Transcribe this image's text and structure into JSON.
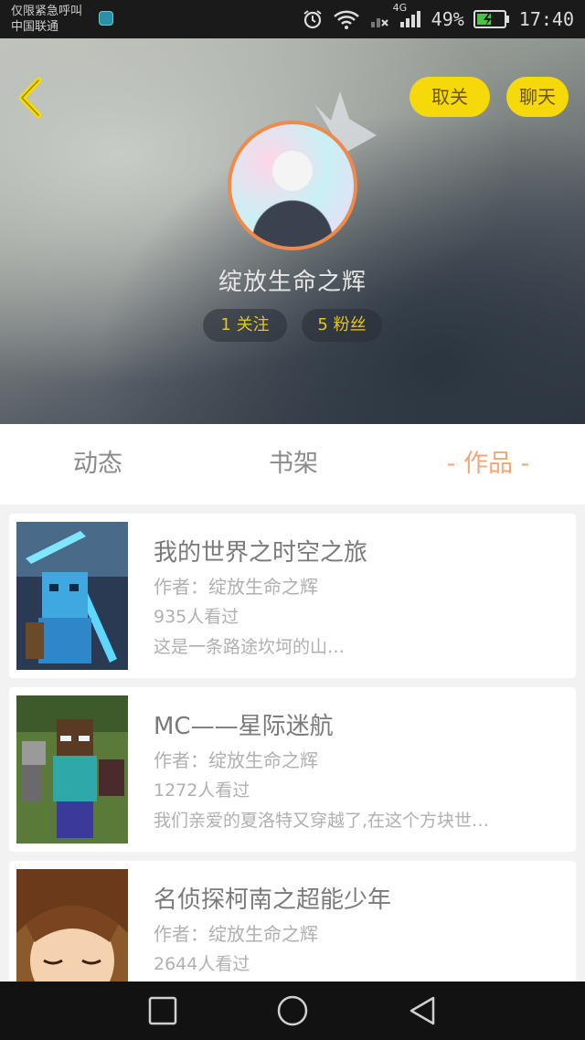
{
  "status_bar": {
    "emergency_text": "仅限紧急呼叫",
    "carrier": "中国联通",
    "network_label": "4G",
    "battery_percent": "49%",
    "time": "17:40"
  },
  "header": {
    "unfollow_label": "取关",
    "chat_label": "聊天",
    "username": "绽放生命之辉",
    "following": "1 关注",
    "fans": "5 粉丝",
    "accent_color": "#f5d90a"
  },
  "tabs": {
    "items": [
      {
        "label": "动态"
      },
      {
        "label": "书架"
      },
      {
        "label": "- 作品 -"
      }
    ],
    "active_color": "#f0a77a"
  },
  "works": [
    {
      "title": "我的世界之时空之旅",
      "author": "作者：绽放生命之辉",
      "views": "935人看过",
      "desc": "这是一条路途坎坷的山…"
    },
    {
      "title": "MC——星际迷航",
      "author": "作者：绽放生命之辉",
      "views": "1272人看过",
      "desc": "我们亲爱的夏洛特又穿越了,在这个方块世…"
    },
    {
      "title": "名侦探柯南之超能少年",
      "author": "作者：绽放生命之辉",
      "views": "2644人看过",
      "desc": ""
    }
  ],
  "icons": {
    "back": "chevron-left-icon",
    "alarm": "alarm-icon",
    "wifi": "wifi-icon",
    "signal": "signal-icon",
    "battery": "battery-icon",
    "nav_recent": "square-icon",
    "nav_home": "circle-icon",
    "nav_back": "triangle-icon"
  }
}
